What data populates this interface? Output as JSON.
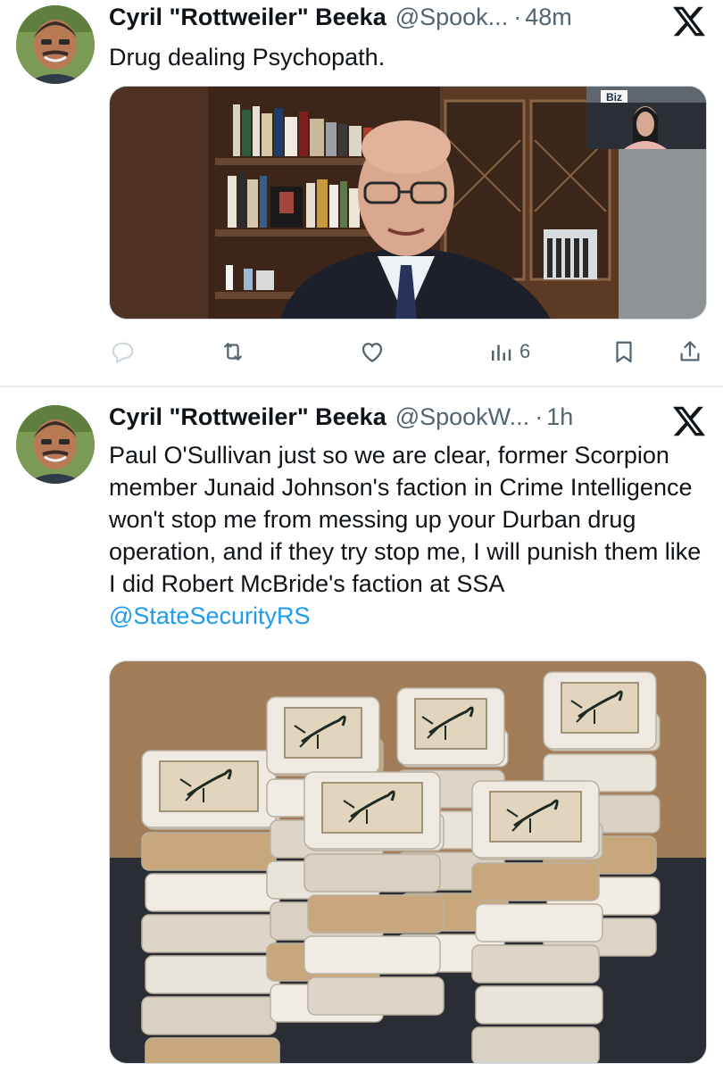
{
  "tweets": [
    {
      "author_name": "Cyril \"Rottweiler\" Beeka",
      "handle": "@Spook...",
      "separator": "·",
      "time": "48m",
      "text": "Drug dealing Psychopath.",
      "media_overlay_label": "Biz",
      "actions": {
        "views_count": "6"
      }
    },
    {
      "author_name": "Cyril \"Rottweiler\" Beeka",
      "handle": "@SpookW...",
      "separator": "·",
      "time": "1h",
      "text": "Paul O'Sullivan just so we are clear, former Scorpion member Junaid Johnson's faction in Crime Intelligence won't stop me from messing up your Durban drug operation, and if they try stop me, I will punish them like I did Robert McBride's faction at SSA ",
      "mention": "@StateSecurityRS"
    }
  ],
  "icons": [
    "x-logo-icon",
    "reply-icon",
    "retweet-icon",
    "like-icon",
    "views-icon",
    "bookmark-icon",
    "share-icon"
  ],
  "colors": {
    "text": "#0f1419",
    "secondary": "#536471",
    "link": "#1d9bf0"
  }
}
